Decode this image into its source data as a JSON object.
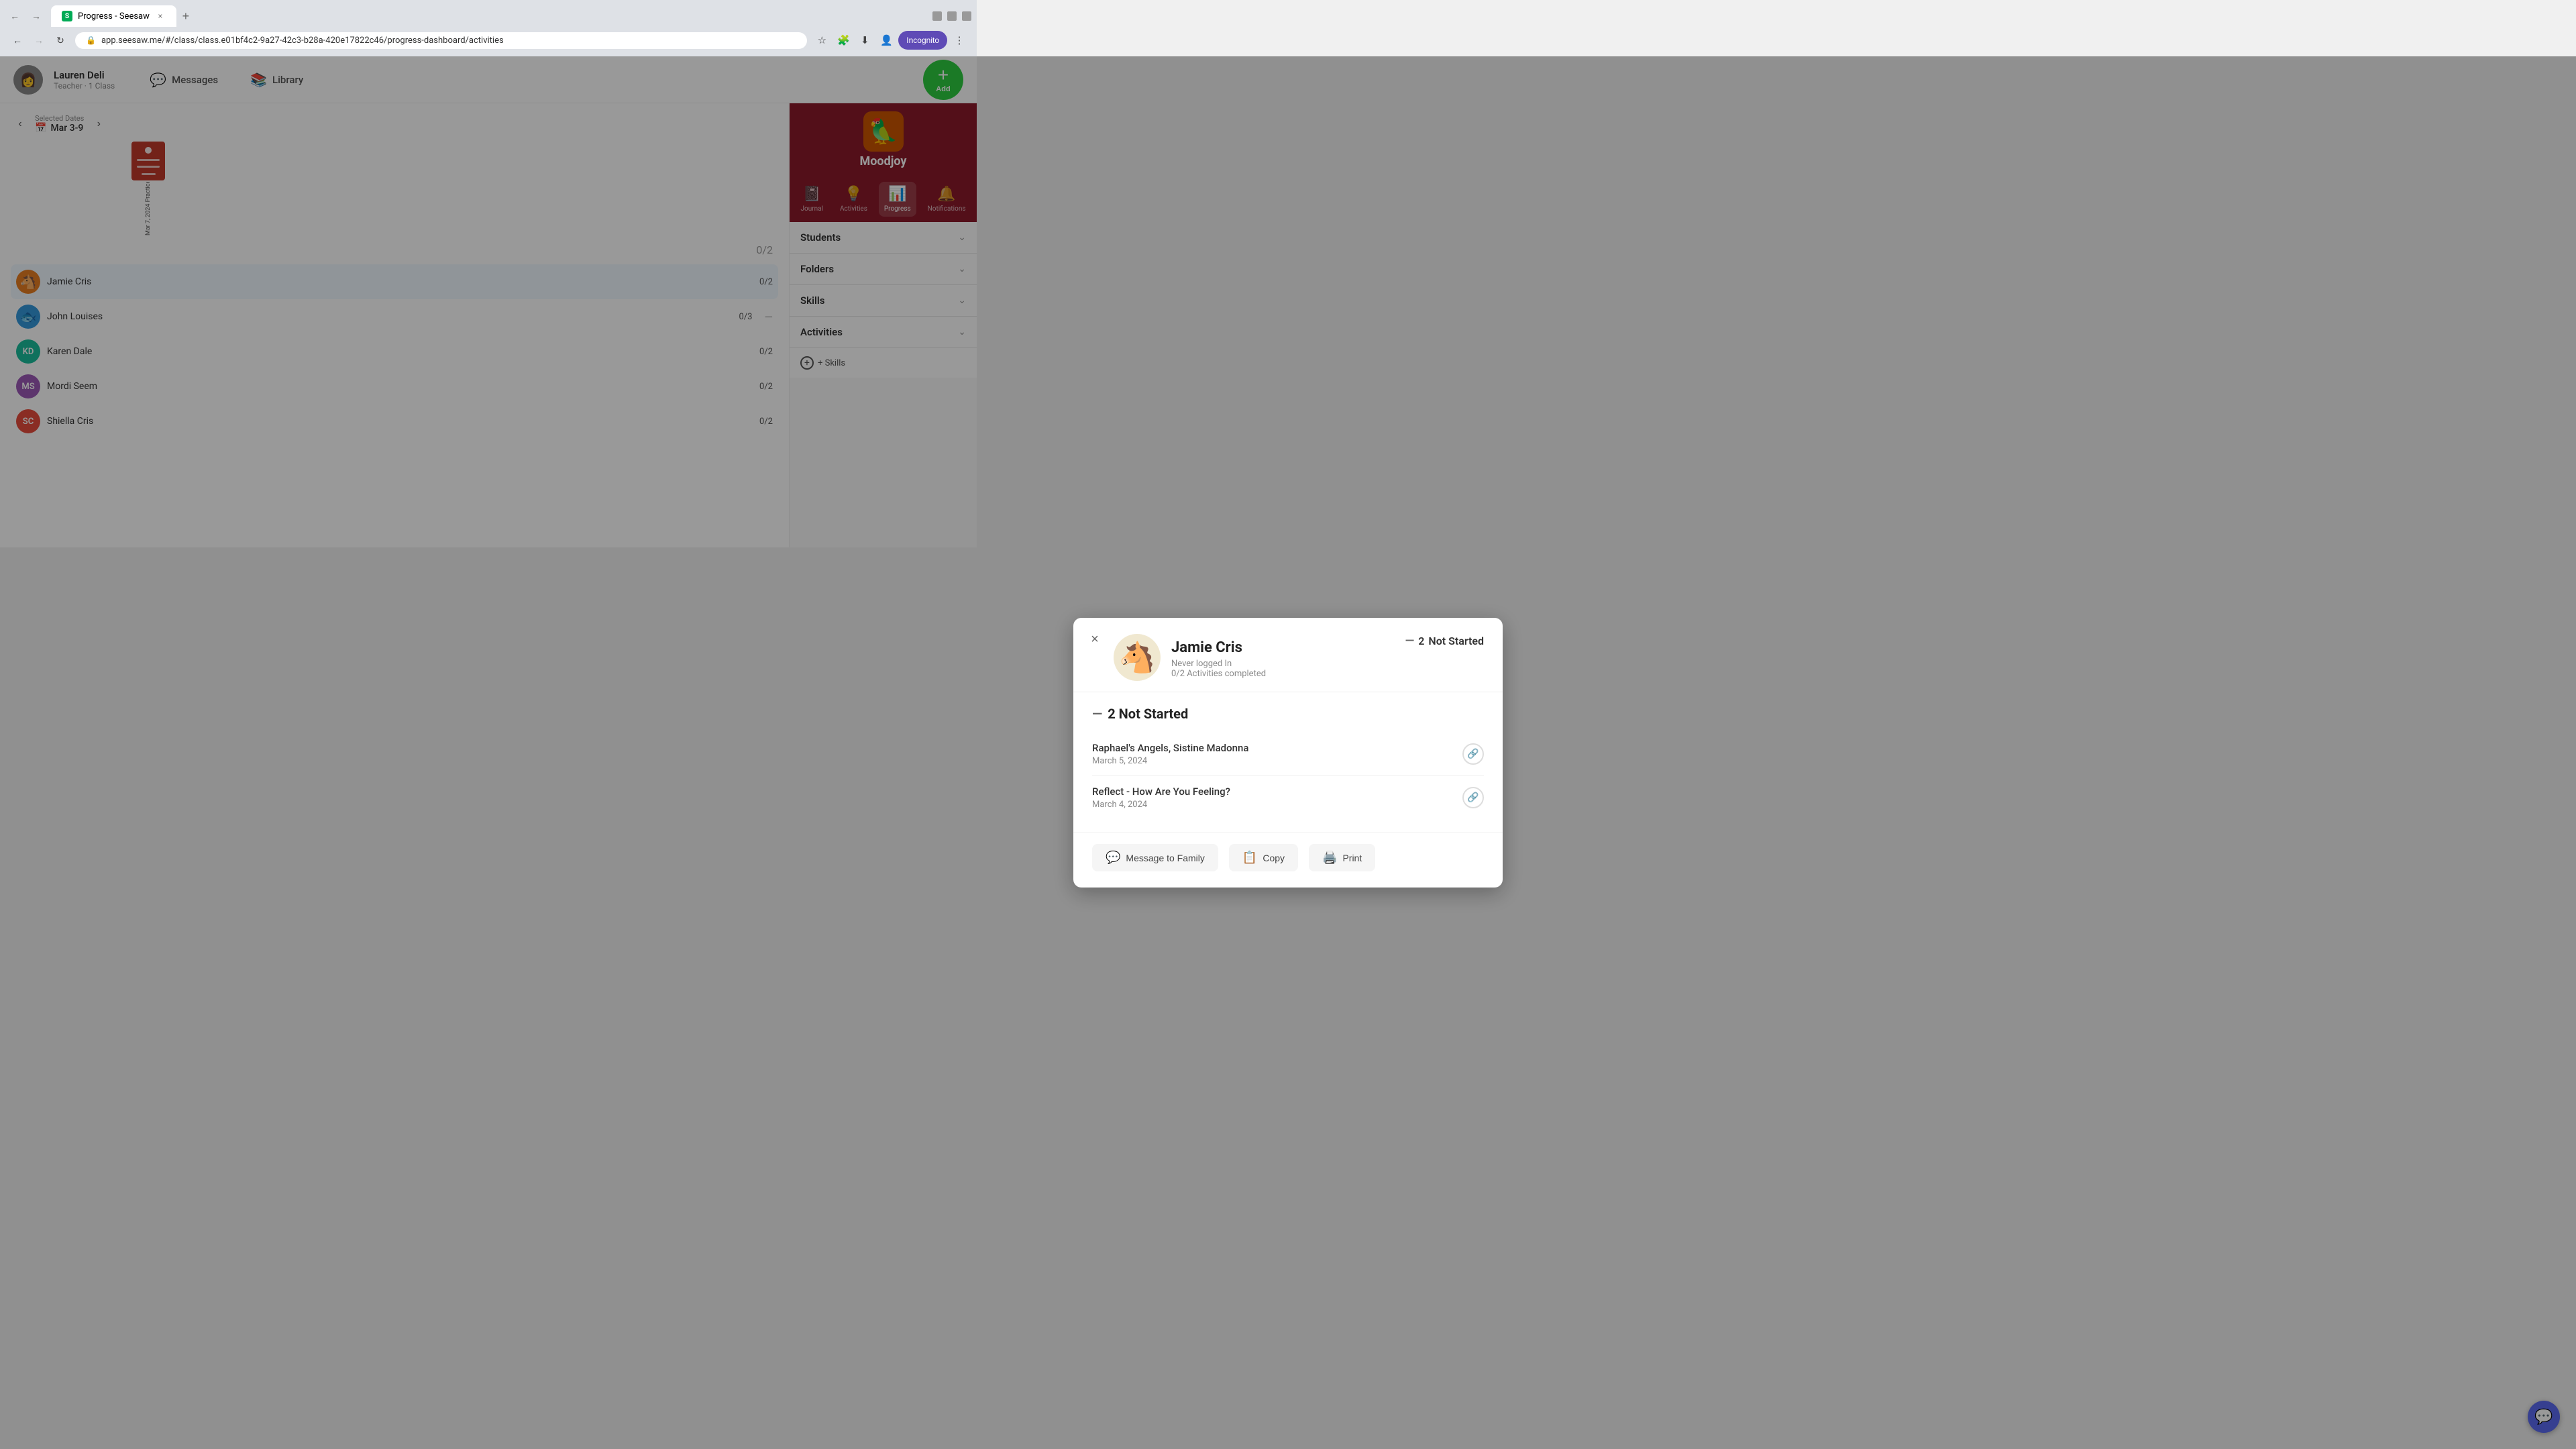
{
  "browser": {
    "tab_title": "Progress - Seesaw",
    "url": "app.seesaw.me/#/class/class.e01bf4c2-9a27-42c3-b28a-420e17822c46/progress-dashboard/activities",
    "favicon": "S",
    "incognito_label": "Incognito"
  },
  "topnav": {
    "user_name": "Lauren Deli",
    "user_role": "Teacher · 1 Class",
    "user_emoji": "👩",
    "messages_label": "Messages",
    "library_label": "Library",
    "add_label": "Add",
    "add_symbol": "+"
  },
  "date_nav": {
    "selected_dates_label": "Selected Dates",
    "date_range": "Mar 3-9",
    "calendar_icon": "📅"
  },
  "activity_thumbnail": {
    "color": "#c0392b"
  },
  "activity_column_header": {
    "date": "Mar 7, 2024",
    "label": "Practice – All About –"
  },
  "students": [
    {
      "id": "JC",
      "name": "Jamie Cris",
      "score": "0/2",
      "avatar_color": "#e67e22",
      "emoji": "🐴"
    },
    {
      "id": "JL",
      "name": "John Louises",
      "score": "0/3",
      "avatar_color": "#3498db",
      "emoji": "🐟"
    },
    {
      "id": "KD",
      "name": "Karen Dale",
      "score": "0/2",
      "avatar_color": "#1abc9c",
      "initials": "KD"
    },
    {
      "id": "MS",
      "name": "Mordi Seem",
      "score": "0/2",
      "avatar_color": "#9b59b6",
      "initials": "MS"
    },
    {
      "id": "SC",
      "name": "Shiella Cris",
      "score": "0/2",
      "avatar_color": "#e74c3c",
      "initials": "SC"
    }
  ],
  "column_score_total": "0/2",
  "right_sidebar": {
    "app_name": "Moodjoy",
    "app_emoji": "🦜",
    "nav_items": [
      {
        "id": "journal",
        "label": "Journal",
        "icon": "📓"
      },
      {
        "id": "activities",
        "label": "Activities",
        "icon": "💡"
      },
      {
        "id": "progress",
        "label": "Progress",
        "icon": "📊",
        "active": true
      },
      {
        "id": "notifications",
        "label": "Notifications",
        "icon": "🔔"
      }
    ],
    "sections": [
      {
        "id": "students",
        "label": "Students"
      },
      {
        "id": "folders",
        "label": "Folders"
      },
      {
        "id": "skills",
        "label": "Skills"
      },
      {
        "id": "activities",
        "label": "Activities"
      }
    ],
    "skills_add_label": "+ Skills"
  },
  "modal": {
    "student_emoji": "🐴",
    "student_name": "Jamie Cris",
    "never_logged": "Never logged In",
    "activities_completed": "0/2 Activities completed",
    "not_started_count": "2",
    "not_started_label": "Not Started",
    "section_title": "2 Not Started",
    "activities": [
      {
        "id": "act1",
        "title": "Raphael's Angels, Sistine Madonna",
        "date": "March 5, 2024"
      },
      {
        "id": "act2",
        "title": "Reflect - How Are You Feeling?",
        "date": "March 4, 2024"
      }
    ],
    "footer_buttons": [
      {
        "id": "message",
        "label": "Message to Family",
        "icon": "💬"
      },
      {
        "id": "copy",
        "label": "Copy",
        "icon": "📋"
      },
      {
        "id": "print",
        "label": "Print",
        "icon": "🖨️"
      }
    ],
    "close_symbol": "×"
  }
}
